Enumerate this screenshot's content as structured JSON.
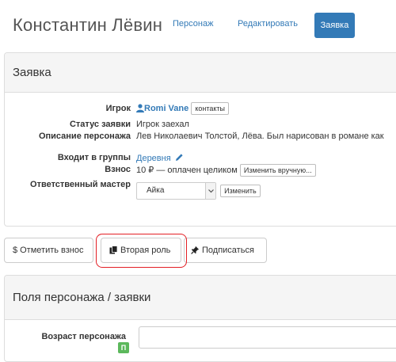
{
  "header": {
    "title": "Константин Лёвин",
    "nav": [
      "Персонаж",
      "Редактировать",
      "Заявка"
    ]
  },
  "claim_panel": {
    "title": "Заявка",
    "rows": {
      "player_label": "Игрок",
      "player_name": "Romi Vane",
      "contacts_button": "контакты",
      "status_label": "Статус заявки",
      "status_value": "Игрок заехал",
      "description_label": "Описание персонажа",
      "description_value": "Лев Николаевич Толстой, Лёва. Был нарисован в романе как",
      "groups_label": "Входит в группы",
      "groups_value": "Деревня",
      "fee_label": "Взнос",
      "fee_value": "10 ₽ — оплачен целиком",
      "fee_change_button": "Изменить вручную...",
      "master_label": "Ответственный мастер",
      "master_selected": "Айка",
      "master_change_button": "Изменить"
    }
  },
  "actions": {
    "mark_fee": "Отметить взнос",
    "second_role": "Вторая роль",
    "subscribe": "Подписаться"
  },
  "fields_panel": {
    "title": "Поля персонажа / заявки",
    "age_label": "Возраст персонажа",
    "age_badge": "П"
  },
  "icons": [
    "user-icon",
    "pencil-icon",
    "dollar-icon",
    "copy-icon",
    "pin-icon",
    "chevron-down-icon"
  ],
  "colors": {
    "accent": "#337ab7",
    "highlight_ring": "#e31e24",
    "badge": "#5cb85c"
  }
}
